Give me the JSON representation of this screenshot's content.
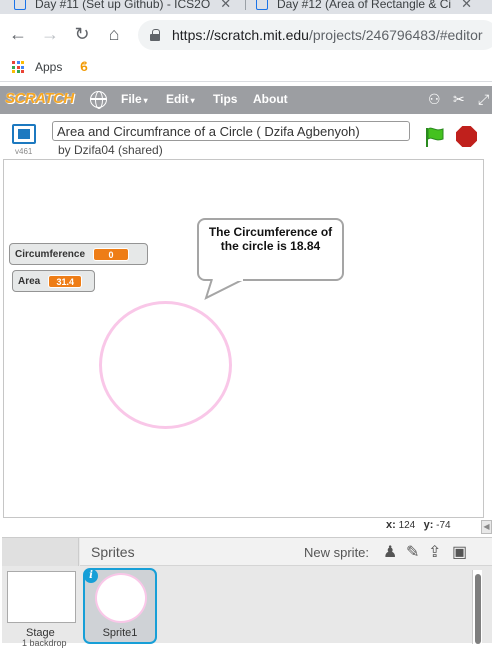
{
  "browser": {
    "tabs": [
      {
        "label": "Day #11 (Set up Github) - ICS2O"
      },
      {
        "label": "Day #12 (Area of Rectangle & Ci"
      }
    ],
    "url_host": "https://scratch.mit.edu",
    "url_path": "/projects/246796483/#editor",
    "bookmarks": {
      "apps_label": "Apps"
    }
  },
  "menubar": {
    "logo": "SCRATCH",
    "file": "File",
    "edit": "Edit",
    "tips": "Tips",
    "about": "About"
  },
  "project": {
    "title": "Area and Circumfrance of a Circle ( Dzifa Agbenyoh)",
    "byline": "by Dzifa04 (shared)",
    "version": "v461"
  },
  "stage": {
    "monitors": [
      {
        "label": "Circumference",
        "value": "0"
      },
      {
        "label": "Area",
        "value": "31.4"
      }
    ],
    "speech": "The Circumference of the circle is 18.84",
    "x_label": "x:",
    "x_value": "124",
    "y_label": "y:",
    "y_value": "-74"
  },
  "sprites_pane": {
    "sprites_label": "Sprites",
    "new_sprite_label": "New sprite:",
    "stage_label": "Stage",
    "stage_sub": "1 backdrop",
    "sprite_name": "Sprite1",
    "info_glyph": "i"
  },
  "icons": {
    "back": "←",
    "forward": "→",
    "reload": "↻",
    "home": "⌂",
    "close": "✕",
    "caret": "▾"
  },
  "colors": {
    "menubar": "#9c9ea2",
    "monitor_value": "#ee7d16",
    "circle_stroke": "#f9c7e8",
    "selection_blue": "#179fd7"
  }
}
